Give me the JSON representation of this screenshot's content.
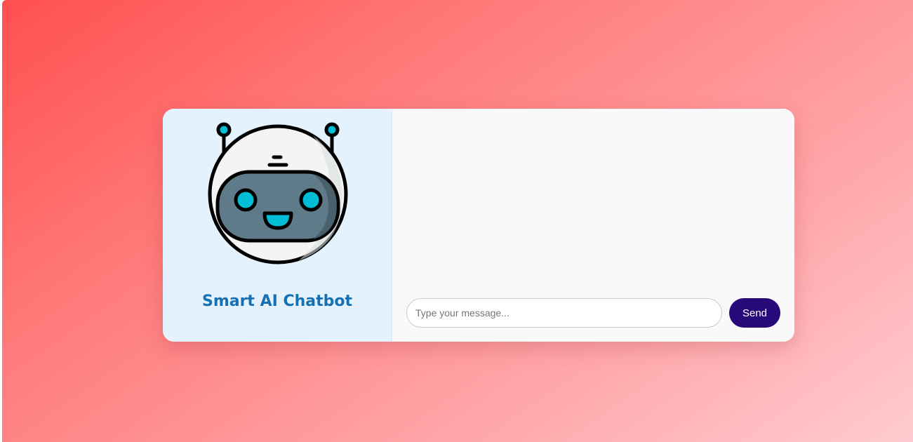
{
  "app": {
    "title": "Smart AI Chatbot",
    "logo_icon": "robot-icon"
  },
  "chat": {
    "messages": [],
    "input_placeholder": "Type your message...",
    "input_value": "",
    "send_label": "Send"
  },
  "colors": {
    "title": "#1670b4",
    "send_button": "#27097a",
    "left_panel": "#e3f2fd",
    "background_gradient": [
      "#ff5050",
      "#ffcbd0"
    ]
  }
}
